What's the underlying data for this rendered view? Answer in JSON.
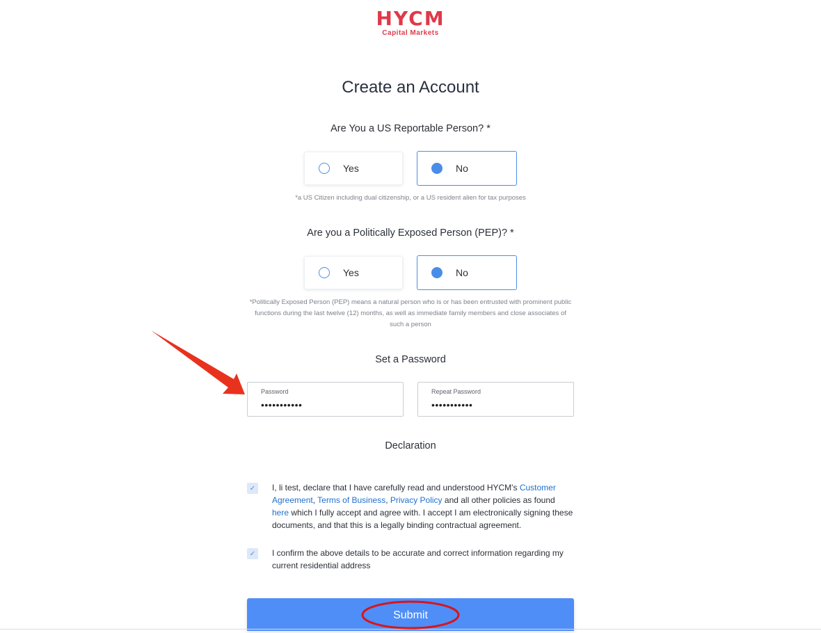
{
  "logo": {
    "main": "HYCM",
    "sub": "Capital Markets"
  },
  "page_title": "Create an Account",
  "us_person": {
    "question": "Are You a US Reportable Person? *",
    "options": [
      {
        "label": "Yes",
        "selected": false
      },
      {
        "label": "No",
        "selected": true
      }
    ],
    "note": "*a US Citizen including dual citizenship, or a US resident alien for tax purposes"
  },
  "pep": {
    "question": "Are you a Politically Exposed Person (PEP)? *",
    "options": [
      {
        "label": "Yes",
        "selected": false
      },
      {
        "label": "No",
        "selected": true
      }
    ],
    "note_lines": [
      "*Politically Exposed Person (PEP) means a natural person who is or has been entrusted with prominent public",
      "functions during the last twelve (12) months, as well as immediate family members and close associates of",
      "such a person"
    ]
  },
  "password_section": {
    "heading": "Set a Password",
    "password": {
      "label": "Password",
      "value": "•••••••••••"
    },
    "repeat": {
      "label": "Repeat Password",
      "value": "•••••••••••"
    }
  },
  "declaration": {
    "heading": "Declaration",
    "item1": {
      "checked": true,
      "text_a": "I, li test, declare that I have carefully read and understood HYCM's ",
      "link_customer": "Customer",
      "link_agreement": "Agreement",
      "sep1": ", ",
      "link_terms": "Terms of Business",
      "sep2": ", ",
      "link_privacy": "Privacy Policy",
      "text_b": " and all other policies as found ",
      "link_here": "here",
      "text_c": " which I fully accept and agree with. I accept I am electronically signing these documents, and that this is a legally binding contractual agreement."
    },
    "item2": {
      "checked": true,
      "text": " I confirm the above details to be accurate and correct information regarding my current residential address"
    }
  },
  "submit_label": "Submit",
  "colors": {
    "brand": "#e0394a",
    "accent": "#4a8de8",
    "button": "#4f8ef7",
    "annotation": "#e8321e"
  },
  "icons": {
    "check": "check-icon",
    "annotation_arrow": "red-arrow-icon",
    "annotation_ellipse": "red-circle-annotation"
  }
}
